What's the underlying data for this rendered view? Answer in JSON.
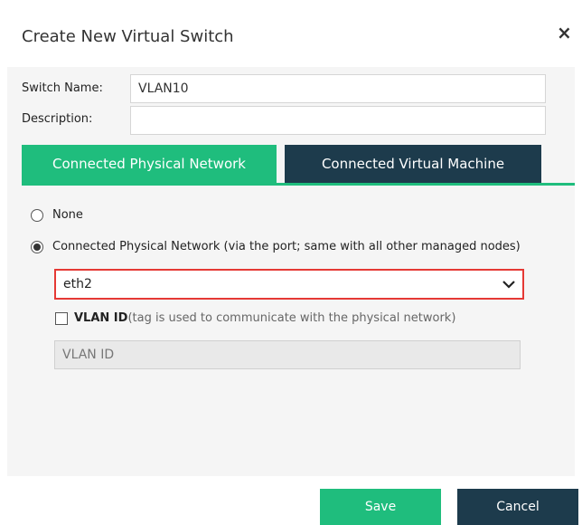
{
  "dialog": {
    "title": "Create New Virtual Switch",
    "close_icon": "×"
  },
  "form": {
    "switch_name_label": "Switch Name:",
    "switch_name_value": "VLAN10",
    "description_label": "Description:",
    "description_value": ""
  },
  "tabs": [
    {
      "label": "Connected Physical Network",
      "active": true
    },
    {
      "label": "Connected Virtual Machine",
      "active": false
    }
  ],
  "options": {
    "none_label": "None",
    "none_checked": false,
    "physical_label": "Connected Physical Network (via the port; same with all other managed nodes)",
    "physical_checked": true
  },
  "port_select": {
    "selected": "eth2"
  },
  "vlan": {
    "checkbox_label": "VLAN ID",
    "checkbox_hint": "(tag is used to communicate with the physical network)",
    "checked": false,
    "input_placeholder": "VLAN ID"
  },
  "buttons": {
    "save": "Save",
    "cancel": "Cancel"
  },
  "colors": {
    "accent_green": "#1fbd7d",
    "dark_navy": "#1d3b4c",
    "highlight_red": "#e53935"
  }
}
